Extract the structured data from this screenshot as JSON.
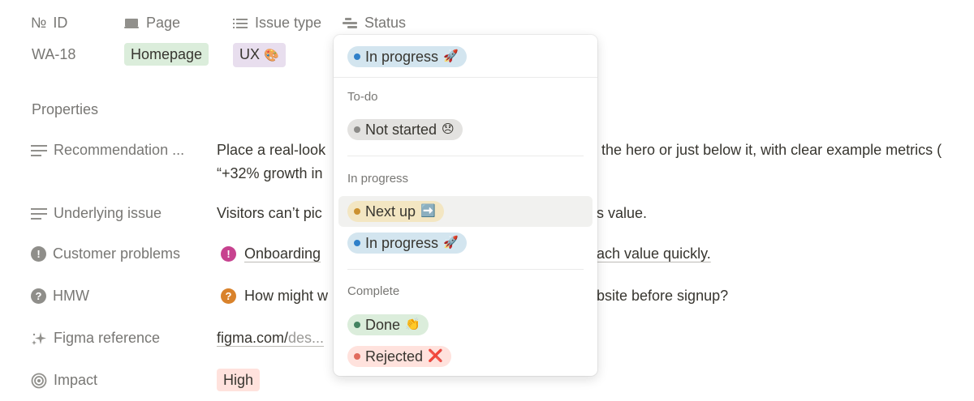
{
  "header": {
    "id_col": "ID",
    "id_prefix": "№",
    "page_col": "Page",
    "issue_type_col": "Issue type",
    "status_col": "Status"
  },
  "row": {
    "id": "WA-18",
    "page": "Homepage",
    "issue_type": "UX",
    "issue_type_emoji": "🎨"
  },
  "properties_heading": "Properties",
  "properties": {
    "recommendation_label": "Recommendation ...",
    "recommendation_line1": "Place a real-look",
    "recommendation_line1_tail": "the hero or just below it, with clear example metrics (",
    "recommendation_line2": "“+32% growth in",
    "underlying_label": "Underlying issue",
    "underlying_value": "Visitors can’t pic",
    "underlying_tail": "s value.",
    "customer_label": "Customer problems",
    "customer_value": "Onboarding",
    "customer_tail": "ach value quickly.",
    "hmw_label": "HMW",
    "hmw_value": "How might w",
    "hmw_tail": "bsite before signup?",
    "figma_label": "Figma reference",
    "figma_domain": "figma.com/",
    "figma_path": "des...",
    "impact_label": "Impact",
    "impact_value": "High"
  },
  "dropdown": {
    "current": "In progress",
    "current_emoji": "🚀",
    "groups": {
      "todo": "To-do",
      "in_progress": "In progress",
      "complete": "Complete"
    },
    "options": {
      "not_started": "Not started",
      "not_started_emoji": "😞",
      "next_up": "Next up",
      "next_up_emoji": "➡️",
      "in_progress": "In progress",
      "in_progress_emoji": "🚀",
      "done": "Done",
      "done_emoji": "👏",
      "rejected": "Rejected",
      "rejected_emoji": "❌"
    }
  },
  "colors": {
    "page_tag_bg": "#dbeddb",
    "ux_tag_bg": "#e8deee",
    "blue_bg": "#d3e5ef",
    "blue_dot": "#2f80c9",
    "gray_bg": "#e3e2e0",
    "gray_dot": "#8c8b88",
    "yellow_bg": "#f3e6c2",
    "yellow_dot": "#cb912f",
    "green_bg": "#dbeddb",
    "green_dot": "#448361",
    "red_bg": "#ffe2dd",
    "red_dot": "#e16b5d",
    "high_bg": "#ffe2dd"
  }
}
